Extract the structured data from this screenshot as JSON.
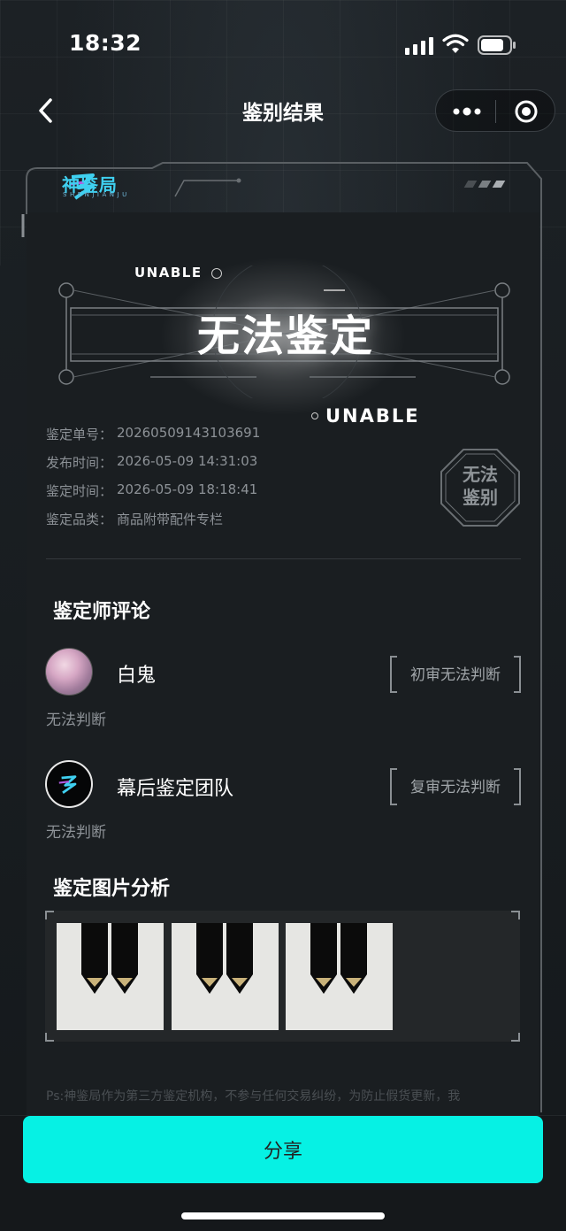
{
  "status_bar": {
    "time": "18:32"
  },
  "nav": {
    "title": "鉴别结果"
  },
  "logo": {
    "name": "神鉴局",
    "sub": "SHENJIANJU"
  },
  "hero": {
    "badge_top": "UNABLE",
    "title": "无法鉴定",
    "badge_bottom": "UNABLE"
  },
  "info": {
    "rows": [
      {
        "label": "鉴定单号：",
        "value": "20260509143103691"
      },
      {
        "label": "发布时间：",
        "value": "2026-05-09 14:31:03"
      },
      {
        "label": "鉴定时间：",
        "value": "2026-05-09 18:18:41"
      },
      {
        "label": "鉴定品类：",
        "value": "商品附带配件专栏"
      }
    ],
    "stamp_line1": "无法",
    "stamp_line2": "鉴别"
  },
  "comments": {
    "title": "鉴定师评论",
    "reviewers": [
      {
        "name": "白鬼",
        "verdict": "初审无法判断",
        "comment": "无法判断"
      },
      {
        "name": "幕后鉴定团队",
        "verdict": "复审无法判断",
        "comment": "无法判断"
      }
    ]
  },
  "gallery": {
    "title": "鉴定图片分析",
    "images": [
      {
        "icon": "product-photo"
      },
      {
        "icon": "product-photo"
      },
      {
        "icon": "product-photo"
      }
    ]
  },
  "disclaimer": "Ps:神鉴局作为第三方鉴定机构，不参与任何交易纠纷，为防止假货更新，我",
  "actions": {
    "share_label": "分享"
  },
  "colors": {
    "accent": "#06f1e4",
    "background": "#161a1d"
  }
}
